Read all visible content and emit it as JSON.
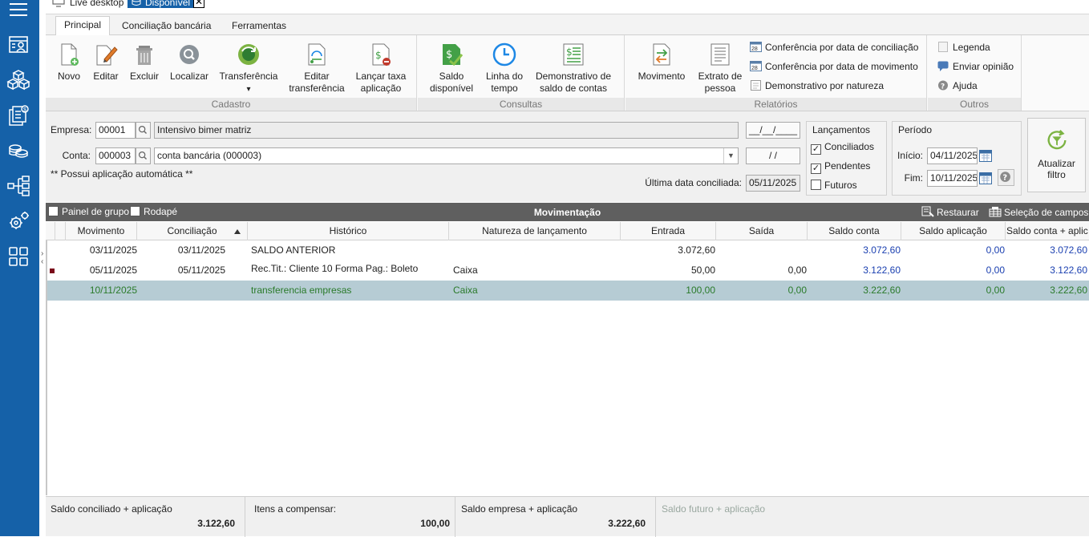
{
  "window_tabs": [
    {
      "label": "Live desktop"
    },
    {
      "label": "Disponível",
      "close": "✕"
    }
  ],
  "ribbon": {
    "tabs": [
      "Principal",
      "Conciliação bancária",
      "Ferramentas"
    ],
    "active_tab": "Principal",
    "groups": {
      "cadastro": {
        "title": "Cadastro",
        "buttons": [
          "Novo",
          "Editar",
          "Excluir",
          "Localizar",
          "Transferência",
          "Editar transferência",
          "Lançar taxa aplicação"
        ]
      },
      "consultas": {
        "title": "Consultas",
        "buttons": [
          "Saldo disponível",
          "Linha do tempo",
          "Demonstrativo de saldo de contas"
        ]
      },
      "relatorios": {
        "title": "Relatórios",
        "buttons": [
          "Movimento",
          "Extrato de pessoa"
        ],
        "small": [
          "Conferência por data de conciliação",
          "Conferência por data de movimento",
          "Demonstrativo por natureza"
        ]
      },
      "outros": {
        "title": "Outros",
        "small": [
          "Legenda",
          "Enviar opinião",
          "Ajuda"
        ]
      }
    },
    "transferencia_arrow": "▾"
  },
  "filters": {
    "empresa_label": "Empresa:",
    "empresa_code": "00001",
    "empresa_name": "Intensivo bimer matriz",
    "date_mask": "__/__/____",
    "conta_label": "Conta:",
    "conta_code": "000003",
    "conta_name": "conta bancária (000003)",
    "date_mask2": "  /  /",
    "aplicacao_note": "** Possui aplicação automática **",
    "ultima_label": "Última data conciliada:",
    "ultima_value": "05/11/2025",
    "lancamentos": {
      "title": "Lançamentos",
      "items": [
        {
          "label": "Conciliados",
          "checked": true
        },
        {
          "label": "Pendentes",
          "checked": true
        },
        {
          "label": "Futuros",
          "checked": false
        }
      ]
    },
    "periodo": {
      "title": "Período",
      "inicio_label": "Início:",
      "inicio_value": "04/11/2025",
      "fim_label": "Fim:",
      "fim_value": "10/11/2025"
    },
    "refresh_label": "Atualizar filtro"
  },
  "grid": {
    "toolbar": {
      "painel_grupo": "Painel de grupo",
      "rodape": "Rodapé",
      "title": "Movimentação",
      "restaurar": "Restaurar",
      "selecao": "Seleção de campos"
    },
    "columns": [
      "Movimento",
      "Conciliação",
      "Histórico",
      "Natureza de lançamento",
      "Entrada",
      "Saída",
      "Saldo conta",
      "Saldo aplicação",
      "Saldo conta + aplic"
    ],
    "rows": [
      {
        "movimento": "03/11/2025",
        "conciliacao": "03/11/2025",
        "historico": "SALDO ANTERIOR",
        "natureza": "",
        "entrada": "3.072,60",
        "saida": "",
        "saldo_conta": "3.072,60",
        "saldo_aplicacao": "0,00",
        "saldo_total": "3.072,60",
        "marker": false,
        "selected": false
      },
      {
        "movimento": "05/11/2025",
        "conciliacao": "05/11/2025",
        "historico": "Rec.Tit.: Cliente 10 Forma Pag.: Boleto",
        "natureza": "Caixa",
        "entrada": "50,00",
        "saida": "0,00",
        "saldo_conta": "3.122,60",
        "saldo_aplicacao": "0,00",
        "saldo_total": "3.122,60",
        "marker": true,
        "selected": false
      },
      {
        "movimento": "10/11/2025",
        "conciliacao": "",
        "historico": "transferencia empresas",
        "natureza": "Caixa",
        "entrada": "100,00",
        "saida": "0,00",
        "saldo_conta": "3.222,60",
        "saldo_aplicacao": "0,00",
        "saldo_total": "3.222,60",
        "marker": false,
        "selected": true
      }
    ]
  },
  "footer": {
    "conciliado_label": "Saldo conciliado + aplicação",
    "conciliado_value": "3.122,60",
    "itens_label": "Itens a compensar:",
    "itens_value": "100,00",
    "empresa_label": "Saldo empresa + aplicação",
    "empresa_value": "3.222,60",
    "futuro_label": "Saldo futuro + aplicação"
  },
  "colors": {
    "rail": "#1561a8",
    "selected_row": "#b6ccd4",
    "balance_text": "#1a3fb0",
    "selected_text": "#2a7a2a"
  }
}
